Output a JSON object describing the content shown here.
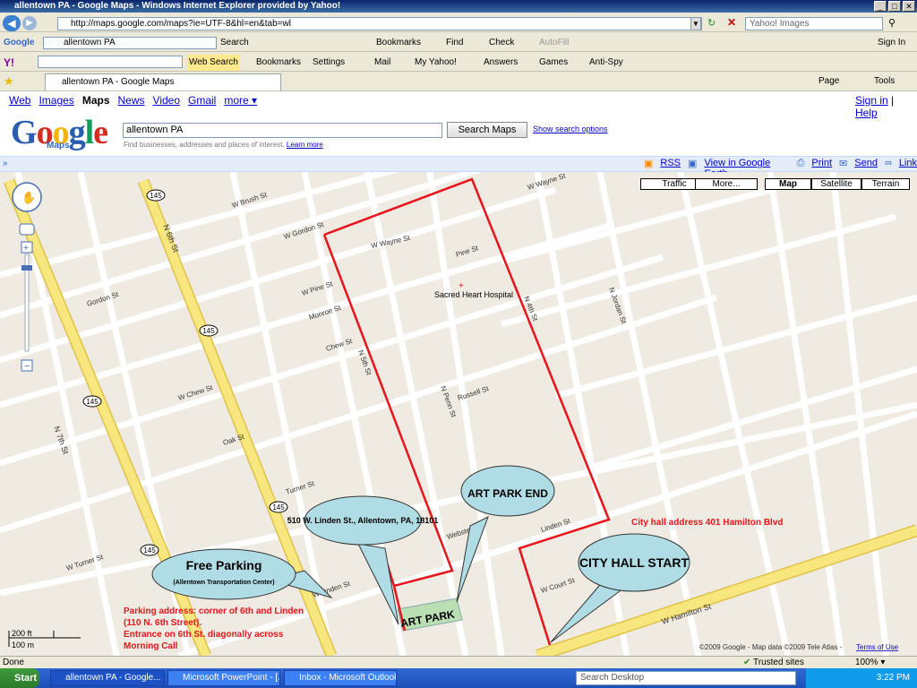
{
  "window": {
    "title": "allentown PA - Google Maps - Windows Internet Explorer provided by Yahoo!",
    "address": "http://maps.google.com/maps?ie=UTF-8&hl=en&tab=wl",
    "search_placeholder": "Yahoo! Images"
  },
  "toolbar_google": {
    "brand": "Google",
    "query": "allentown PA",
    "items": [
      "Search",
      "Bookmarks",
      "Find",
      "Check",
      "AutoFill",
      "Sign In"
    ]
  },
  "toolbar_yahoo": {
    "brand": "Y!",
    "items": [
      "Web Search",
      "Bookmarks",
      "Settings",
      "Mail",
      "My Yahoo!",
      "Answers",
      "Games",
      "Anti-Spy"
    ]
  },
  "tab": {
    "label": "allentown PA - Google Maps",
    "right_items": [
      "Page",
      "Tools"
    ]
  },
  "google_nav": {
    "links": [
      "Web",
      "Images",
      "Maps",
      "News",
      "Video",
      "Gmail",
      "more ▾"
    ],
    "active": "Maps",
    "sign_in": "Sign in",
    "help": "Help"
  },
  "search": {
    "logo": "Google",
    "sub": "Maps",
    "query": "allentown PA",
    "button": "Search Maps",
    "options_link": "Show search options",
    "hint": "Find businesses, addresses and places of interest.",
    "learn_more": "Learn more"
  },
  "map_links": [
    "RSS",
    "View in Google Earth",
    "Print",
    "Send",
    "Link"
  ],
  "map_types": [
    "Traffic",
    "More...",
    "Map",
    "Satellite",
    "Terrain"
  ],
  "map_type_active": "Map",
  "map": {
    "streets_ns": [
      "N 7th St",
      "N 6th St",
      "N 5th St",
      "N 4th St",
      "N Penn St",
      "N Lumber St",
      "N Law St",
      "N Jordan St",
      "N Church St",
      "N Fenwick St"
    ],
    "streets_ew": [
      "W Linden St",
      "Linden St",
      "W Hamilton St",
      "W Court St",
      "W Turner St",
      "Turner St",
      "W Chew St",
      "Chew St",
      "W Gordon St",
      "Gordon St",
      "W Wayne St",
      "W Pine St",
      "Pine St",
      "W Brush St",
      "Monroe St",
      "Russell St",
      "Oak St",
      "Webster St",
      "W Wayne St"
    ],
    "route_shields": [
      "145",
      "145",
      "145",
      "145",
      "145"
    ],
    "poi": "Sacred Heart Hospital",
    "scale": [
      "200 ft",
      "100 m"
    ],
    "copyright": "©2009 Google - Map data ©2009 Tele Atlas - ",
    "terms": "Terms of Use"
  },
  "callouts": {
    "art_park_end": "ART PARK END",
    "city_hall": "CITY HALL START",
    "linden_address": "510 W. Linden St., Allentown, PA, 18101",
    "free_parking_title": "Free Parking",
    "free_parking_sub": "(Allentown Transportation Center)",
    "art_park_label": "ART PARK"
  },
  "notes": {
    "city_hall_address": "City hall address 401 Hamilton Blvd",
    "parking_lines": [
      "Parking address: corner of 6th and Linden",
      "(110 N. 6th Street).",
      "Entrance on 6th St. diagonally across",
      "Morning Call"
    ]
  },
  "colors": {
    "route": "#e8131b",
    "callout_fill": "#b0dde5",
    "note_text": "#e8131b",
    "highway": "#f7e77e"
  },
  "status_bar": {
    "left": "Done",
    "zone": "Trusted sites",
    "zoom": "100%"
  },
  "taskbar": {
    "start": "Start",
    "tasks": [
      "allentown PA - Google...",
      "Microsoft PowerPoint - [...",
      "Inbox - Microsoft Outlook"
    ],
    "search_desktop": "Search Desktop",
    "time": "3:22 PM"
  }
}
